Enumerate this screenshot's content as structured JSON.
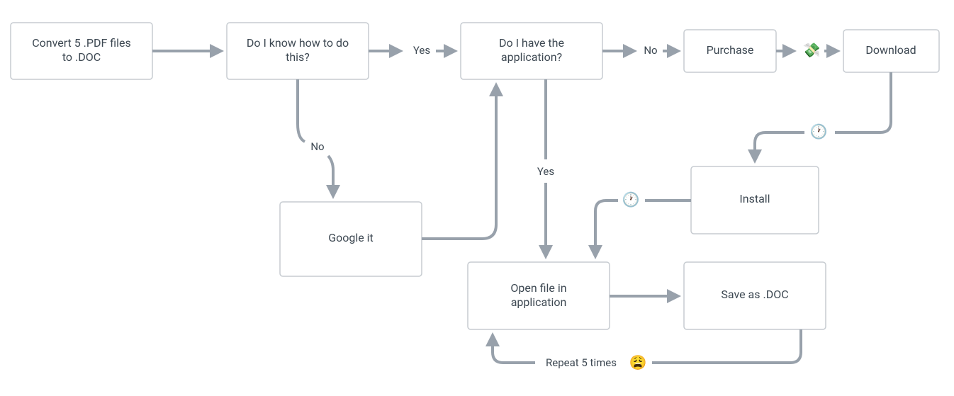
{
  "diagram": {
    "nodes": {
      "convert": {
        "label_l1": "Convert 5 .PDF files",
        "label_l2": "to .DOC"
      },
      "know": {
        "label_l1": "Do I know how to do",
        "label_l2": "this?"
      },
      "have": {
        "label_l1": "Do I have the",
        "label_l2": "application?"
      },
      "purchase": {
        "label": "Purchase"
      },
      "download": {
        "label": "Download"
      },
      "google": {
        "label": "Google it"
      },
      "install": {
        "label": "Install"
      },
      "open": {
        "label_l1": "Open file in",
        "label_l2": "application"
      },
      "save": {
        "label": "Save as .DOC"
      }
    },
    "edge_labels": {
      "know_yes": "Yes",
      "know_no": "No",
      "have_no": "No",
      "have_yes": "Yes",
      "repeat": "Repeat 5 times"
    },
    "emoji": {
      "money": "💸",
      "clock1": "🕐",
      "clock2": "🕐",
      "tired": "😩"
    }
  }
}
